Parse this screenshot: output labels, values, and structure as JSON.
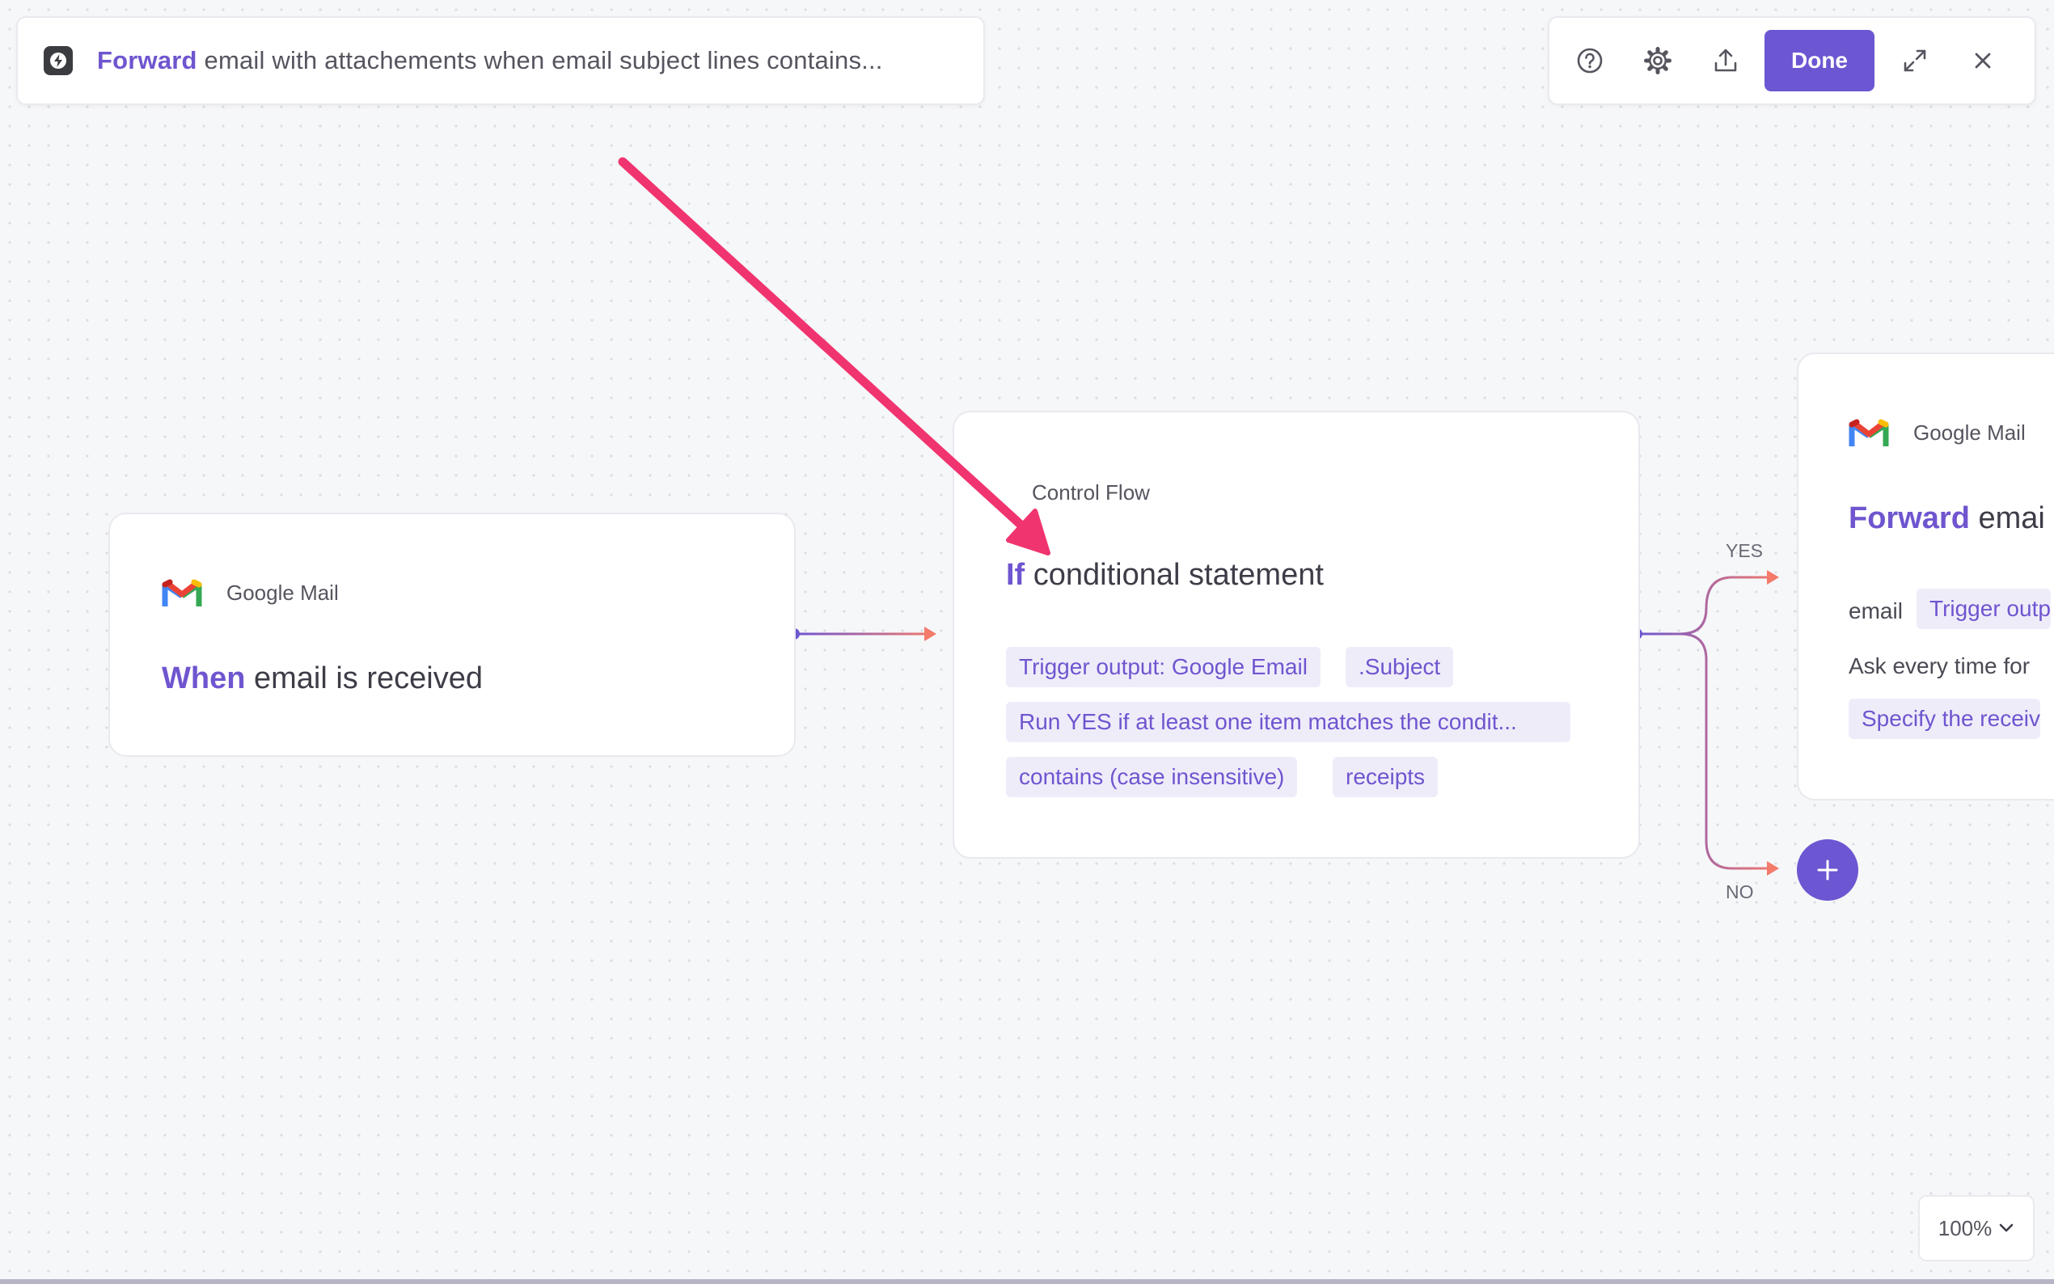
{
  "header": {
    "title_accent": "Forward",
    "title_rest": "email with attachements when email subject lines contains...",
    "done_label": "Done"
  },
  "trigger_node": {
    "app_name": "Google Mail",
    "keyword": "When",
    "title": "email is received"
  },
  "condition_node": {
    "category": "Control Flow",
    "keyword": "If",
    "title": "conditional statement",
    "chips": {
      "source": "Trigger output: Google Email",
      "field": ".Subject",
      "mode": "Run YES if at least one item matches the condit...",
      "operator": "contains (case insensitive)",
      "value": "receipts"
    }
  },
  "branches": {
    "yes": "YES",
    "no": "NO"
  },
  "action_node": {
    "app_name": "Google Mail",
    "keyword": "Forward",
    "title": "emai",
    "param_label": "email",
    "param_chip": "Trigger outp",
    "ask_text": "Ask every time for",
    "specify_chip": "Specify the receiv"
  },
  "zoom": {
    "level": "100%"
  },
  "colors": {
    "accent": "#6c56d2",
    "arrow": "#f0346f",
    "edge_start": "#6c56d2",
    "edge_end": "#f47a6a"
  }
}
